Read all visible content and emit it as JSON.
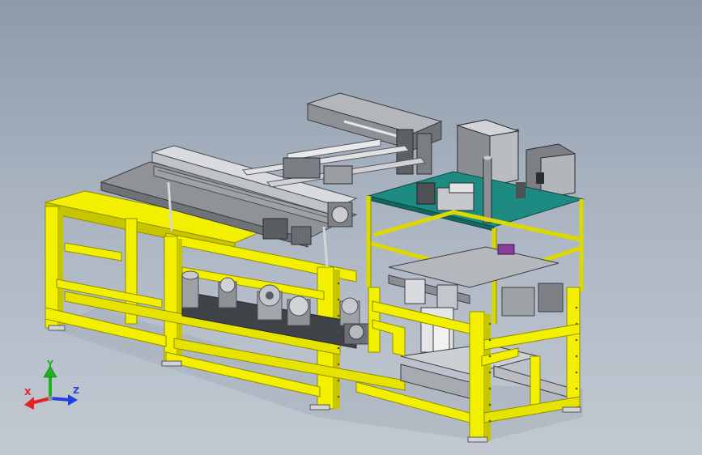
{
  "viewport": {
    "background_top": "#8e9aab",
    "background_bottom": "#c2c9d2"
  },
  "colors": {
    "frame_yellow": "#f2ef00",
    "frame_yellow_shade": "#c7c400",
    "frame_dark": "#8f8d00",
    "metal_light": "#d7d9dc",
    "metal_mid": "#a9acb1",
    "metal_dark": "#4b4e54",
    "panel_teal": "#1e8b82",
    "axis_x": "#e32222",
    "axis_y": "#1fb21f",
    "axis_z": "#2140e0"
  },
  "triad": {
    "x_label": "X",
    "y_label": "Y",
    "z_label": "Z"
  }
}
